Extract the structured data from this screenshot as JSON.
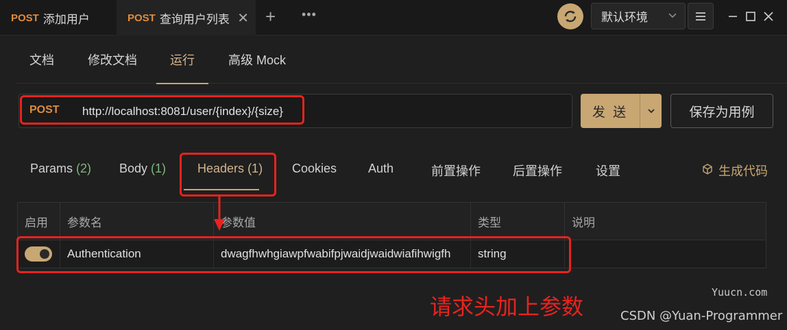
{
  "tabbar": {
    "tabs": [
      {
        "method": "POST",
        "label": "添加用户"
      },
      {
        "method": "POST",
        "label": "查询用户列表"
      }
    ],
    "close_glyph": "✕",
    "add_glyph": "+",
    "more_glyph": "•••",
    "environment": "默认环境"
  },
  "subtabs": [
    "文档",
    "修改文档",
    "运行",
    "高级 Mock"
  ],
  "request": {
    "method": "POST",
    "url": "http://localhost:8081/user/{index}/{size}",
    "send_label": "发 送",
    "save_label": "保存为用例"
  },
  "req_tabs": [
    {
      "label": "Params",
      "count": "(2)"
    },
    {
      "label": "Body",
      "count": "(1)"
    },
    {
      "label": "Headers",
      "count": "(1)"
    },
    {
      "label": "Cookies",
      "count": ""
    },
    {
      "label": "Auth",
      "count": ""
    },
    {
      "label": "前置操作",
      "count": ""
    },
    {
      "label": "后置操作",
      "count": ""
    },
    {
      "label": "设置",
      "count": ""
    }
  ],
  "gen_code_label": "生成代码",
  "headers_table": {
    "columns": [
      "启用",
      "参数名",
      "参数值",
      "类型",
      "说明"
    ],
    "rows": [
      {
        "enabled": true,
        "name": "Authentication",
        "value": "dwagfhwhgiawpfwabifpjwaidjwaidwiafihwigfh",
        "type": "string",
        "desc": ""
      }
    ]
  },
  "annotation": "请求头加上参数",
  "watermarks": {
    "site": "Yuucn.com",
    "author": "CSDN @Yuan-Programmer"
  },
  "colors": {
    "accent": "#c8a773",
    "method": "#e08b3d",
    "annotation": "#e8231e",
    "count": "#7fb77e"
  }
}
